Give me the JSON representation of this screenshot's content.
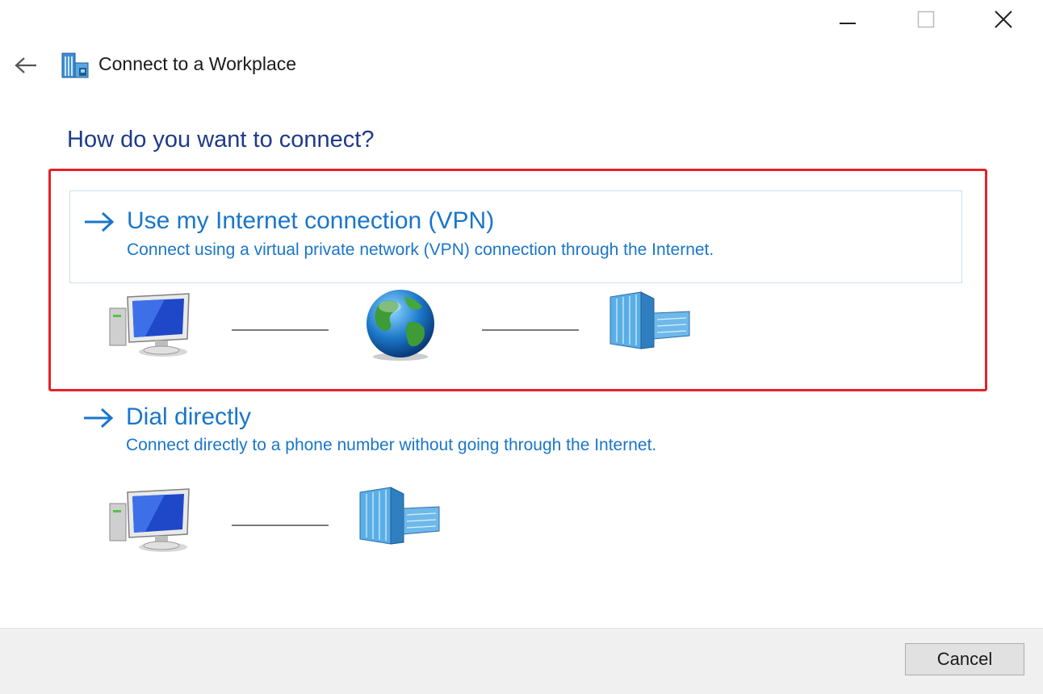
{
  "window": {
    "title": "Connect to a Workplace",
    "controls": {
      "minimize_icon": "minimize-icon",
      "maximize_icon": "maximize-icon",
      "close_icon": "close-icon"
    }
  },
  "heading": "How do you want to connect?",
  "options": [
    {
      "title": "Use my Internet connection (VPN)",
      "description": "Connect using a virtual private network (VPN) connection through the Internet.",
      "diagram": [
        "computer-icon",
        "globe-icon",
        "building-icon"
      ],
      "highlighted": true
    },
    {
      "title": "Dial directly",
      "description": "Connect directly to a phone number without going through the Internet.",
      "diagram": [
        "computer-icon",
        "building-icon"
      ],
      "highlighted": false
    }
  ],
  "footer": {
    "cancel_label": "Cancel"
  },
  "colors": {
    "accent": "#1a76c9",
    "heading": "#1e3a8a",
    "highlight_border": "#e8202a"
  }
}
